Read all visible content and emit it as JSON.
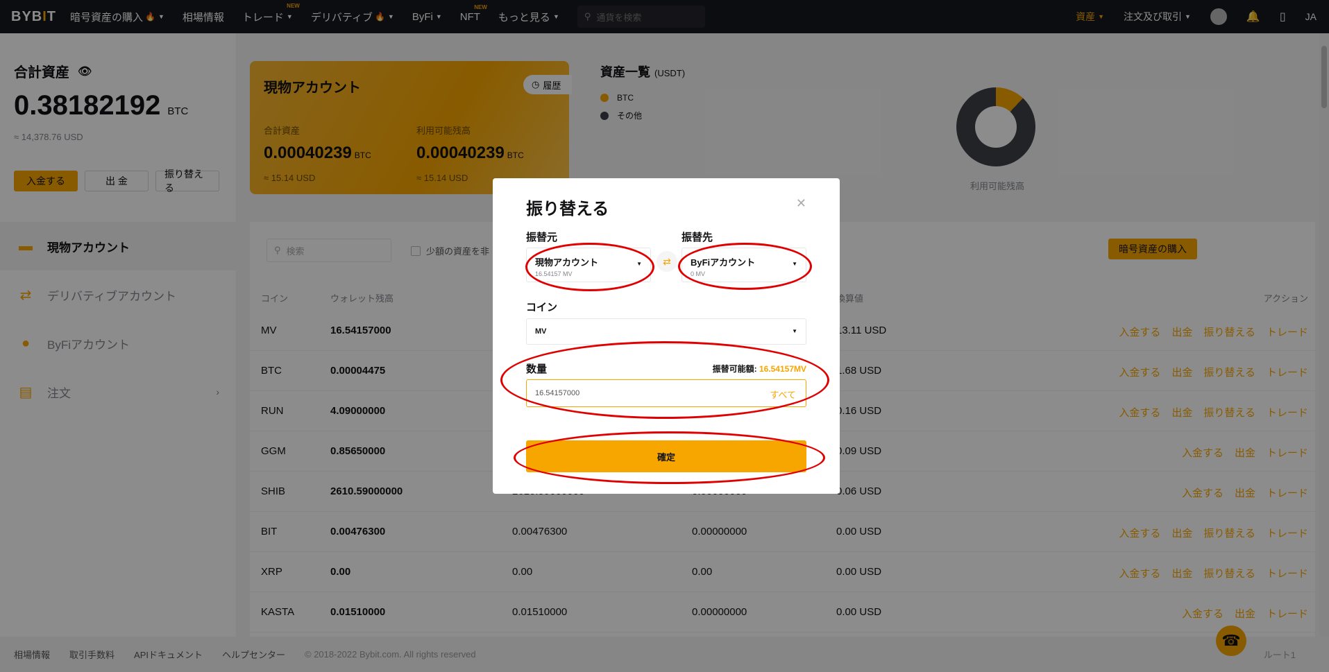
{
  "nav": {
    "logo": "BYBIT",
    "items": [
      {
        "label": "暗号資産の購入",
        "flame": true,
        "caret": true,
        "new": false
      },
      {
        "label": "相場情報",
        "flame": false,
        "caret": false,
        "new": false
      },
      {
        "label": "トレード",
        "flame": false,
        "caret": true,
        "new": true
      },
      {
        "label": "デリバティブ",
        "flame": true,
        "caret": true,
        "new": false
      },
      {
        "label": "ByFi",
        "flame": false,
        "caret": true,
        "new": false
      },
      {
        "label": "NFT",
        "flame": false,
        "caret": false,
        "new": true
      },
      {
        "label": "もっと見る",
        "flame": false,
        "caret": true,
        "new": false
      }
    ],
    "new_tag": "NEW",
    "search_placeholder": "通貨を検索",
    "assets": "資産",
    "orders": "注文及び取引",
    "lang": "JA"
  },
  "summary": {
    "title": "合計資産",
    "value": "0.38182192",
    "unit": "BTC",
    "usd": "≈ 14,378.76 USD",
    "deposit": "入金する",
    "withdraw": "出 金",
    "transfer": "振り替える"
  },
  "menu": [
    {
      "label": "現物アカウント",
      "icon": "wallet-icon",
      "active": true
    },
    {
      "label": "デリバティブアカウント",
      "icon": "swap-arrows-icon",
      "active": false
    },
    {
      "label": "ByFiアカウント",
      "icon": "piggy-bank-icon",
      "active": false
    },
    {
      "label": "注文",
      "icon": "clipboard-icon",
      "active": false,
      "arrow": "›"
    }
  ],
  "spot_card": {
    "title": "現物アカウント",
    "history": "履歴",
    "total_label": "合計資産",
    "total_value": "0.00040239",
    "total_unit": "BTC",
    "total_usd": "≈ 15.14 USD",
    "avail_label": "利用可能残高",
    "avail_value": "0.00040239",
    "avail_unit": "BTC",
    "avail_usd": "≈ 15.14 USD"
  },
  "asset_overview": {
    "title": "資産一覧",
    "unit": "(USDT)",
    "legend": [
      {
        "label": "BTC",
        "color": "#f7a600"
      },
      {
        "label": "その他",
        "color": "#3f4048"
      }
    ],
    "donut_label": "利用可能残高"
  },
  "table": {
    "search_placeholder": "検索",
    "hide_small": "少額の資産を非",
    "buy_button": "暗号資産の購入",
    "headers": {
      "coin": "コイン",
      "wallet": "ウォレット残高",
      "usd": "換算値",
      "action": "アクション"
    },
    "rows": [
      {
        "coin": "MV",
        "wallet": "16.54157000",
        "avail": "",
        "frozen": "",
        "usd": "13.11 USD",
        "actions": [
          "入金する",
          "出金",
          "振り替える",
          "トレード"
        ]
      },
      {
        "coin": "BTC",
        "wallet": "0.00004475",
        "avail": "",
        "frozen": "",
        "usd": "1.68 USD",
        "actions": [
          "入金する",
          "出金",
          "振り替える",
          "トレード"
        ]
      },
      {
        "coin": "RUN",
        "wallet": "4.09000000",
        "avail": "",
        "frozen": "",
        "usd": "0.16 USD",
        "actions": [
          "入金する",
          "出金",
          "振り替える",
          "トレード"
        ]
      },
      {
        "coin": "GGM",
        "wallet": "0.85650000",
        "avail": "",
        "frozen": "",
        "usd": "0.09 USD",
        "actions": [
          "入金する",
          "出金",
          "トレード"
        ]
      },
      {
        "coin": "SHIB",
        "wallet": "2610.59000000",
        "avail": "2610.59000000",
        "frozen": "0.00000000",
        "usd": "0.06 USD",
        "actions": [
          "入金する",
          "出金",
          "トレード"
        ]
      },
      {
        "coin": "BIT",
        "wallet": "0.00476300",
        "avail": "0.00476300",
        "frozen": "0.00000000",
        "usd": "0.00 USD",
        "actions": [
          "入金する",
          "出金",
          "振り替える",
          "トレード"
        ]
      },
      {
        "coin": "XRP",
        "wallet": "0.00",
        "avail": "0.00",
        "frozen": "0.00",
        "usd": "0.00 USD",
        "actions": [
          "入金する",
          "出金",
          "振り替える",
          "トレード"
        ]
      },
      {
        "coin": "KASTA",
        "wallet": "0.01510000",
        "avail": "0.01510000",
        "frozen": "0.00000000",
        "usd": "0.00 USD",
        "actions": [
          "入金する",
          "出金",
          "トレード"
        ]
      }
    ]
  },
  "footer": {
    "links": [
      "相場情報",
      "取引手数料",
      "APIドキュメント",
      "ヘルプセンター"
    ],
    "copyright": "© 2018-2022 Bybit.com. All rights reserved",
    "right": "ルート1"
  },
  "modal": {
    "title": "振り替える",
    "from_label": "振替元",
    "from_account": "現物アカウント",
    "from_balance": "16.54157 MV",
    "to_label": "振替先",
    "to_account": "ByFiアカウント",
    "to_balance": "0 MV",
    "coin_label": "コイン",
    "coin_value": "MV",
    "qty_label": "数量",
    "available_label": "振替可能額:",
    "available_value": "16.54157MV",
    "qty_value": "16.54157000",
    "all": "すべて",
    "confirm": "確定"
  },
  "colors": {
    "accent": "#f7a600",
    "annotation": "#e00000",
    "nav_bg": "#17181e"
  }
}
